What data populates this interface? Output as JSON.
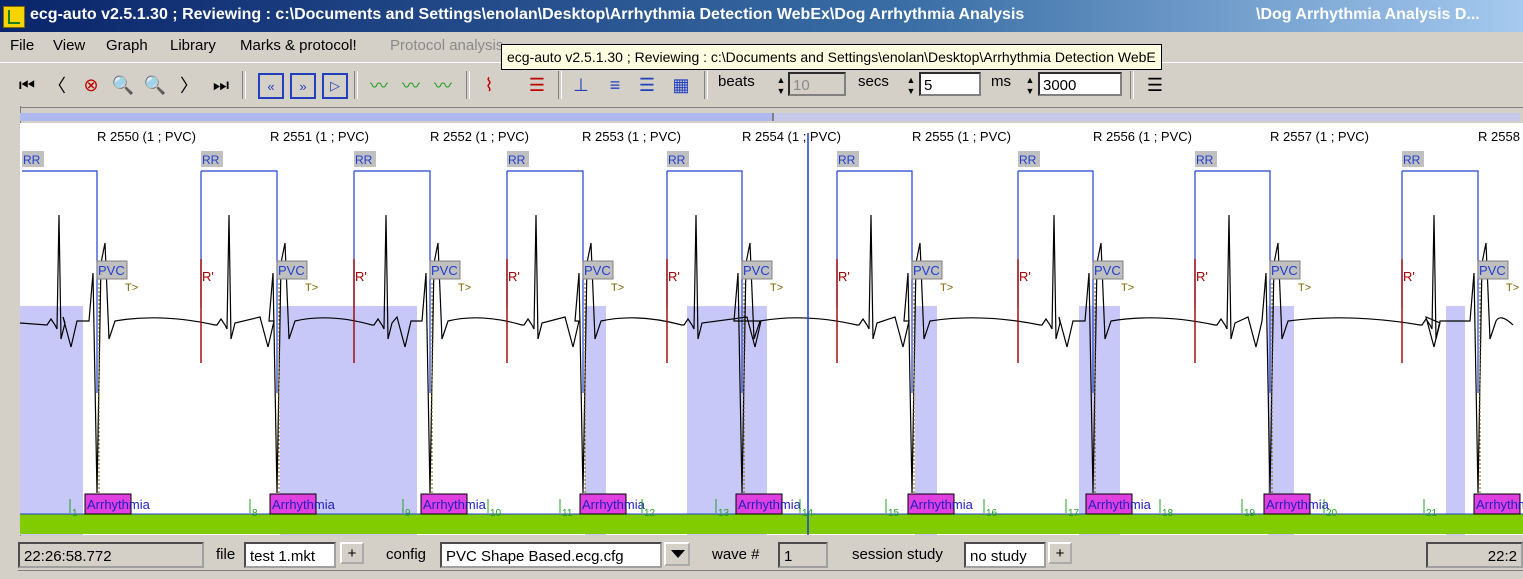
{
  "window": {
    "title": "ecg-auto v2.5.1.30 ; Reviewing : c:\\Documents and Settings\\enolan\\Desktop\\Arrhythmia Detection WebEx\\Dog Arrhythmia Analysis",
    "title_right": "\\Dog Arrhythmia Analysis D..."
  },
  "menu": {
    "file": "File",
    "view": "View",
    "graph": "Graph",
    "library": "Library",
    "marks": "Marks & protocol!",
    "protocol_analysis": "Protocol analysis"
  },
  "tooltip": "ecg-auto v2.5.1.30 ; Reviewing : c:\\Documents and Settings\\enolan\\Desktop\\Arrhythmia Detection WebE",
  "toolbar": {
    "beats_label": "beats",
    "beats_value": "10",
    "secs_label": "secs",
    "secs_value": "5",
    "ms_label": "ms",
    "ms_value": "3000"
  },
  "ecg": {
    "beat_labels": [
      "R 2550 (1 ; PVC)",
      "R 2551 (1 ; PVC)",
      "R 2552 (1 ; PVC)",
      "R 2553 (1 ; PVC)",
      "R 2554 (1 ; PVC)",
      "R 2555 (1 ; PVC)",
      "R 2556 (1 ; PVC)",
      "R 2557 (1 ; PVC)",
      "R 2558"
    ],
    "rr_label": "RR",
    "rprime_label": "R'",
    "pvc_label": "PVC",
    "t_label": "T>",
    "arrhythmia_label": "Arrhythmia",
    "tick_numbers": [
      "1",
      "8",
      "9",
      "10",
      "11",
      "12",
      "13",
      "14",
      "15",
      "16",
      "17",
      "18",
      "19",
      "20",
      "21"
    ],
    "colors": {
      "highlight": "#c8c8f8",
      "rr_box": "#2040d0",
      "rprime": "#a00000",
      "pvc_badge": "#c0c0c0",
      "arrhythmia_badge": "#e040e0",
      "baseline": "#80cc00",
      "cursor": "#2040d0"
    }
  },
  "status": {
    "time": "22:26:58.772",
    "file_label": "file",
    "file_value": "test 1.mkt",
    "config_label": "config",
    "config_value": "PVC Shape Based.ecg.cfg",
    "wave_label": "wave #",
    "wave_value": "1",
    "session_label": "session study",
    "session_value": "no study",
    "plus": "+",
    "time_right": "22:2"
  }
}
